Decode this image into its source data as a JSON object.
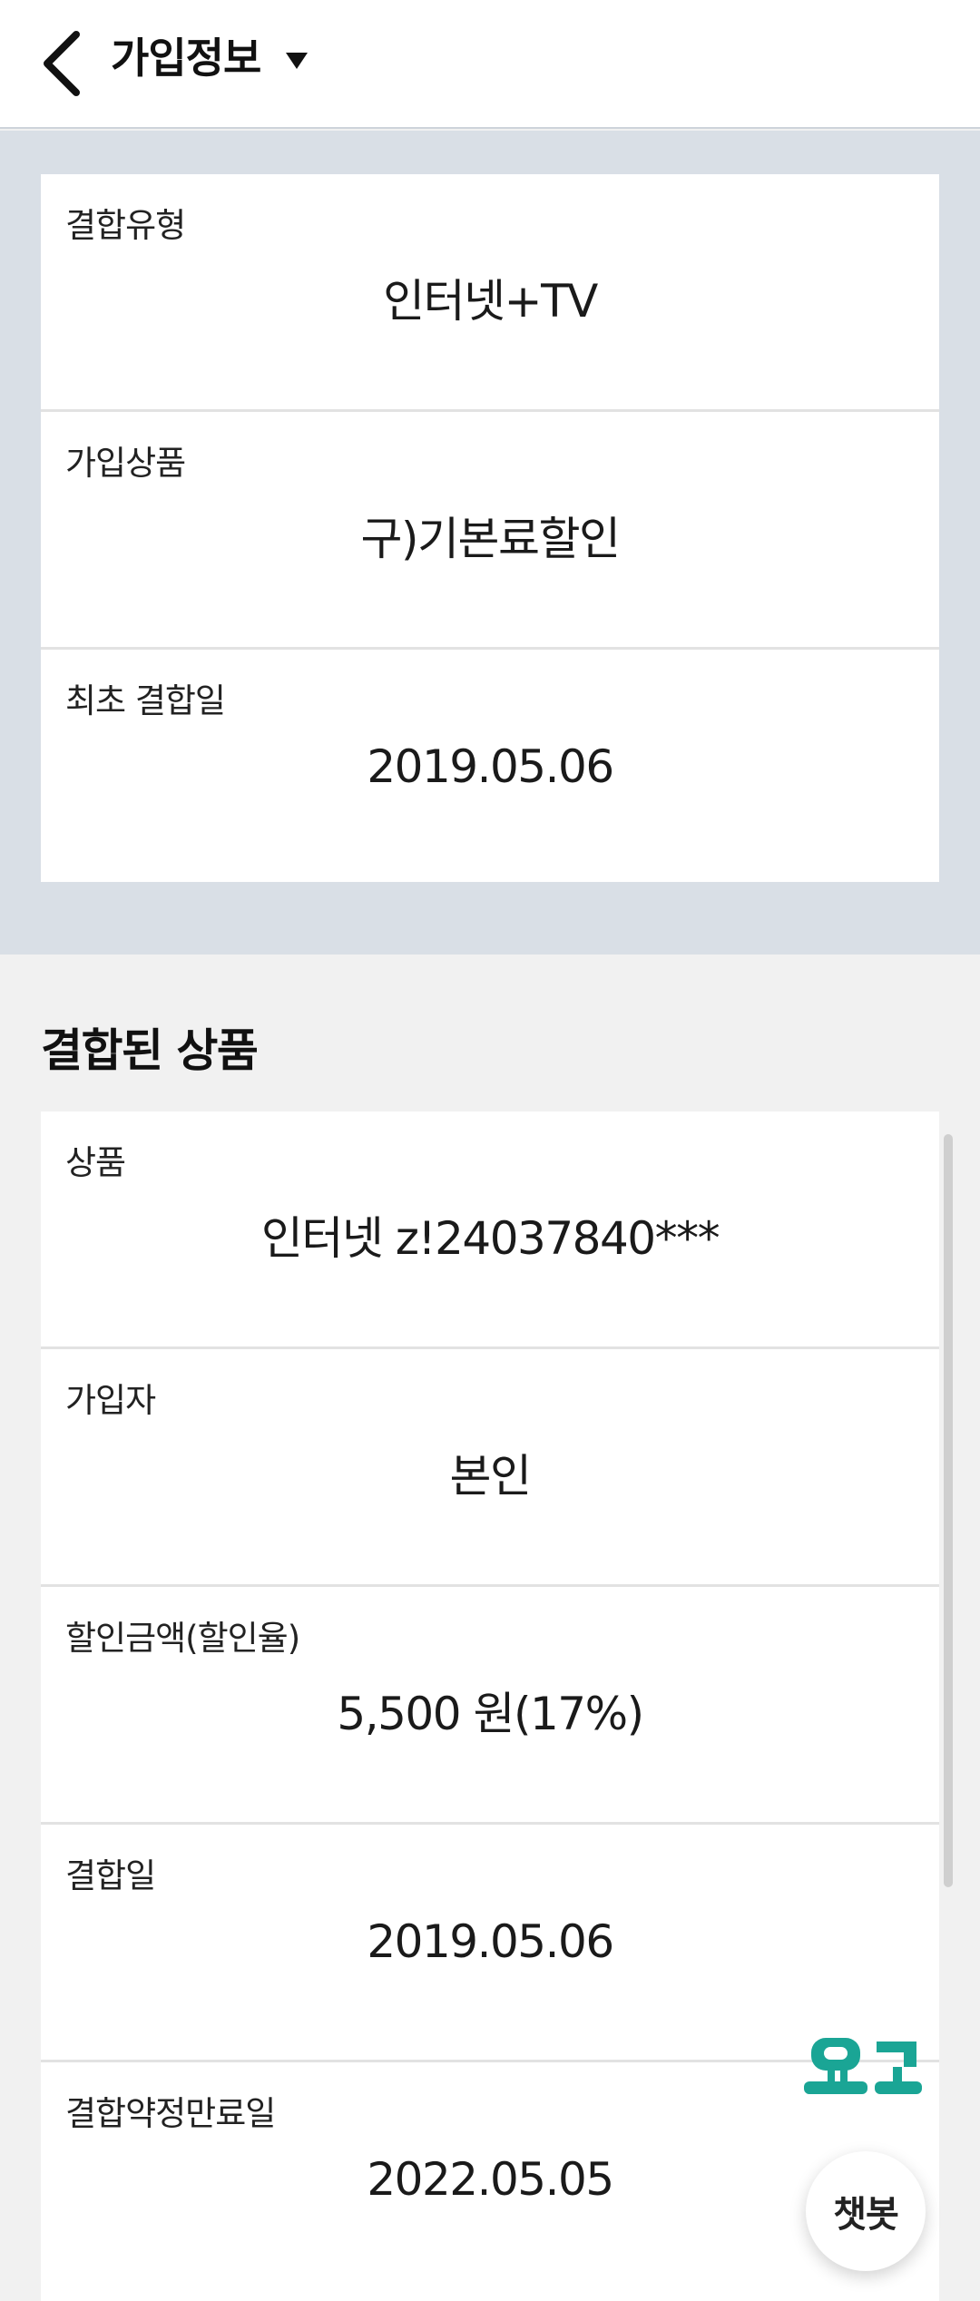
{
  "header": {
    "title": "가입정보",
    "back_icon": "chevron-left-icon",
    "dropdown_icon": "caret-down-icon"
  },
  "summary": {
    "rows": [
      {
        "label": "결합유형",
        "value": "인터넷+TV"
      },
      {
        "label": "가입상품",
        "value": "구)기본료할인"
      },
      {
        "label": "최초 결합일",
        "value": "2019.05.06"
      }
    ]
  },
  "products": {
    "title": "결합된 상품",
    "rows": [
      {
        "label": "상품",
        "value": "인터넷 z!24037840***"
      },
      {
        "label": "가입자",
        "value": "본인"
      },
      {
        "label": "할인금액(할인율)",
        "value": "5,500 원(17%)"
      },
      {
        "label": "결합일",
        "value": "2019.05.06"
      },
      {
        "label": "결합약정만료일",
        "value": "2022.05.05"
      }
    ]
  },
  "floating": {
    "logo_text": "요고",
    "chatbot_label": "챗봇"
  },
  "colors": {
    "band": "#d9dfe6",
    "page": "#f1f1f1",
    "logo": "#1aa595"
  }
}
